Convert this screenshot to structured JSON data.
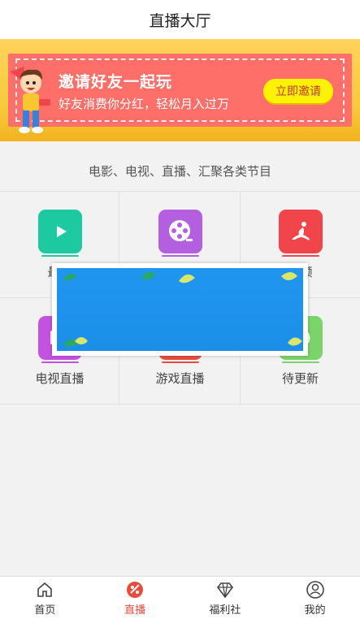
{
  "header": {
    "title": "直播大厅"
  },
  "banner": {
    "title": "邀请好友一起玩",
    "subtitle": "好友消费你分红，轻松月入过万",
    "button_label": "立即邀请"
  },
  "section": {
    "subtitle": "电影、电视、直播、汇聚各类节目"
  },
  "grid": {
    "items": [
      {
        "label": "最新",
        "icon": "play-icon",
        "color": "#1dc9a0"
      },
      {
        "label": "",
        "icon": "film-reel-icon",
        "color": "#b45fe0"
      },
      {
        "label": "视频",
        "icon": "dancer-icon",
        "color": "#f0464b"
      },
      {
        "label": "电视直播",
        "icon": "tv-icon",
        "color": "#c452e0"
      },
      {
        "label": "游戏直播",
        "icon": "game-icon",
        "color": "#e74c3c"
      },
      {
        "label": "待更新",
        "icon": "pending-icon",
        "color": "#7bd46a"
      }
    ]
  },
  "tabbar": {
    "items": [
      {
        "label": "首页",
        "icon": "home-icon"
      },
      {
        "label": "直播",
        "icon": "live-icon",
        "active": true
      },
      {
        "label": "福利社",
        "icon": "diamond-icon"
      },
      {
        "label": "我的",
        "icon": "user-icon"
      }
    ]
  }
}
